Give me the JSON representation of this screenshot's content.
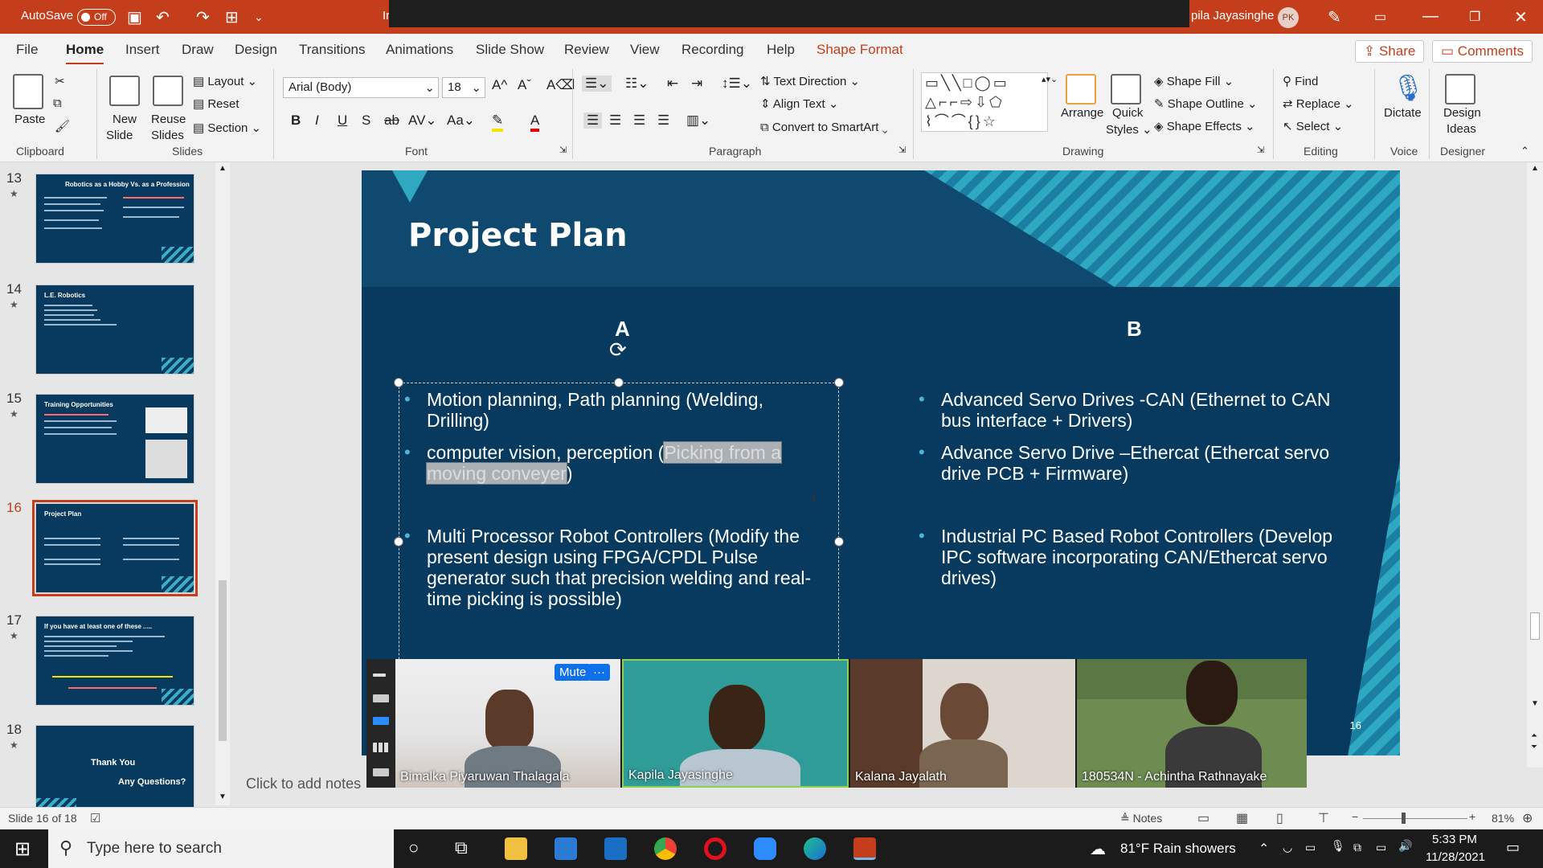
{
  "titlebar": {
    "autosave_label": "AutoSave",
    "autosave_state": "Off",
    "doc_title_fragment": "Ir",
    "user_name": "pila Jayasinghe",
    "user_initials": "PK"
  },
  "tabs": [
    "File",
    "Home",
    "Insert",
    "Draw",
    "Design",
    "Transitions",
    "Animations",
    "Slide Show",
    "Review",
    "View",
    "Recording",
    "Help",
    "Shape Format"
  ],
  "share_label": "Share",
  "comments_label": "Comments",
  "ribbon": {
    "clipboard": {
      "paste": "Paste",
      "group": "Clipboard"
    },
    "slides": {
      "new_slide": "New\nSlide",
      "new_line1": "New",
      "new_line2": "Slide",
      "reuse_line1": "Reuse",
      "reuse_line2": "Slides",
      "layout": "Layout",
      "reset": "Reset",
      "section": "Section",
      "group": "Slides"
    },
    "font": {
      "name": "Arial (Body)",
      "size": "18",
      "group": "Font"
    },
    "paragraph": {
      "text_direction": "Text Direction",
      "align_text": "Align Text",
      "convert_smartart": "Convert to SmartArt",
      "group": "Paragraph"
    },
    "drawing": {
      "arrange": "Arrange",
      "quick_styles_1": "Quick",
      "quick_styles_2": "Styles",
      "shape_fill": "Shape Fill",
      "shape_outline": "Shape Outline",
      "shape_effects": "Shape Effects",
      "group": "Drawing"
    },
    "editing": {
      "find": "Find",
      "replace": "Replace",
      "select": "Select",
      "group": "Editing"
    },
    "voice": {
      "dictate": "Dictate",
      "group": "Voice"
    },
    "designer": {
      "design_ideas_1": "Design",
      "design_ideas_2": "Ideas",
      "group": "Designer"
    }
  },
  "thumbnails": [
    {
      "num": "13",
      "title": "Robotics as a Hobby Vs. as a Profession"
    },
    {
      "num": "14",
      "title": "L.E. Robotics"
    },
    {
      "num": "15",
      "title": "Training Opportunities"
    },
    {
      "num": "16",
      "title": "Project Plan"
    },
    {
      "num": "17",
      "title": "If you have at least one of these ....."
    },
    {
      "num": "18",
      "title": "Thank You",
      "subtitle": "Any Questions?"
    }
  ],
  "slide": {
    "title": "Project Plan",
    "col_a": "A",
    "col_b": "B",
    "a_items": [
      "Motion planning, Path planning  (Welding, Drilling)",
      "computer vision, perception (",
      "Picking from a",
      "moving conveyer",
      ")",
      "Multi Processor Robot Controllers (Modify the present design using FPGA/CPDL Pulse generator such that precision welding and real-time picking is possible)"
    ],
    "b_items": [
      "Advanced Servo Drives -CAN (Ethernet to CAN bus interface + Drivers)",
      "Advance Servo Drive –Ethercat (Ethercat servo drive PCB + Firmware)",
      "Industrial PC Based Robot Controllers (Develop IPC software incorporating CAN/Ethercat servo drives)"
    ],
    "number": "16"
  },
  "notes_placeholder": "Click to add notes",
  "video": {
    "mute_label": "Mute",
    "more_label": "···",
    "participants": [
      "Bimalka Piyaruwan Thalagala",
      "Kapila Jayasinghe",
      "Kalana Jayalath",
      "180534N - Achintha Rathnayake"
    ]
  },
  "statusbar": {
    "slide_count": "Slide 16 of 18",
    "notes": "Notes",
    "zoom": "81%"
  },
  "taskbar": {
    "search_placeholder": "Type here to search",
    "weather": "81°F  Rain showers",
    "time": "5:33 PM",
    "date": "11/28/2021"
  },
  "colors": {
    "accent": "#c43e1c",
    "slide_bg": "#073a5e",
    "stripe": "#2fa8c2"
  }
}
